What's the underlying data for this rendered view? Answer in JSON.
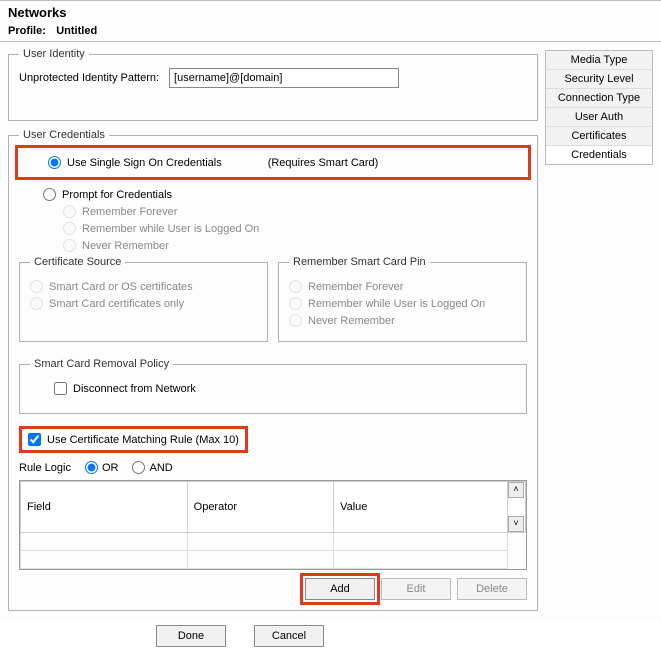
{
  "window": {
    "title": "Networks",
    "profile_label": "Profile:",
    "profile_name": "Untitled"
  },
  "side_tabs": [
    {
      "label": "Media Type",
      "selected": false
    },
    {
      "label": "Security Level",
      "selected": false
    },
    {
      "label": "Connection Type",
      "selected": false
    },
    {
      "label": "User Auth",
      "selected": false
    },
    {
      "label": "Certificates",
      "selected": false
    },
    {
      "label": "Credentials",
      "selected": true
    }
  ],
  "user_identity": {
    "legend": "User Identity",
    "pattern_label": "Unprotected Identity Pattern:",
    "pattern_value": "[username]@[domain]"
  },
  "user_credentials": {
    "legend": "User Credentials",
    "sso_label": "Use Single Sign On Credentials",
    "sso_note": "(Requires Smart Card)",
    "prompt_label": "Prompt for Credentials",
    "remember_forever": "Remember Forever",
    "remember_logged": "Remember while User is Logged On",
    "never_remember": "Never Remember"
  },
  "cert_source": {
    "legend": "Certificate Source",
    "opt1": "Smart Card or OS certificates",
    "opt2": "Smart Card certificates only"
  },
  "remember_pin": {
    "legend": "Remember Smart Card Pin",
    "opt1": "Remember Forever",
    "opt2": "Remember while User is Logged On",
    "opt3": "Never Remember"
  },
  "smart_card_policy": {
    "legend": "Smart Card Removal Policy",
    "disconnect": "Disconnect from Network"
  },
  "cert_matching": {
    "label": "Use Certificate Matching Rule (Max 10)"
  },
  "rule_logic": {
    "label": "Rule Logic",
    "or": "OR",
    "and": "AND"
  },
  "table": {
    "col_field": "Field",
    "col_operator": "Operator",
    "col_value": "Value"
  },
  "buttons": {
    "add": "Add",
    "edit": "Edit",
    "delete": "Delete",
    "done": "Done",
    "cancel": "Cancel"
  }
}
